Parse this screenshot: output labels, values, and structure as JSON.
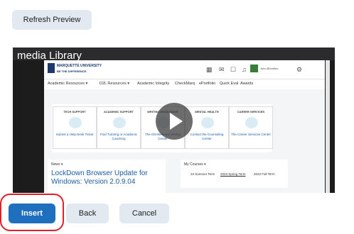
{
  "toolbar": {
    "refresh_label": "Refresh Preview"
  },
  "video": {
    "title": "media Library",
    "logo_line1": "MARQUETTE UNIVERSITY",
    "logo_line2": "BE THE DIFFERENCE.",
    "user_name": "John Blondino",
    "nav": [
      "Academic Resources ▾",
      "D2L Resources ▾",
      "Academic Integrity",
      "CheckMarq",
      "ePortfolio",
      "Quick Eval",
      "Awards"
    ],
    "cards": [
      {
        "title": "TECH SUPPORT",
        "text": "Submit a Help Desk Ticket"
      },
      {
        "title": "ACADEMIC SUPPORT",
        "text": "Find Tutoring or Academic Coaching"
      },
      {
        "title": "WRITING ASSISTANCE",
        "text": "The Ott Memorial Writing Center"
      },
      {
        "title": "MENTAL HEALTH",
        "text": "Contact the Counseling Center"
      },
      {
        "title": "CAREER SERVICES",
        "text": "The Career Services Center"
      }
    ],
    "news_label": "News ▾",
    "news_headline": "LockDown Browser Update for Windows: Version 2.0.9.04",
    "courses_label": "My Courses ▾",
    "terms": [
      "23 Summer Term",
      "2023 Spring Term",
      "2022 Fall Term"
    ]
  },
  "buttons": {
    "insert": "Insert",
    "back": "Back",
    "cancel": "Cancel"
  },
  "colors": {
    "primary": "#1f6fbf",
    "secondary_bg": "#e3e9f1",
    "annotation": "#e0202a"
  }
}
